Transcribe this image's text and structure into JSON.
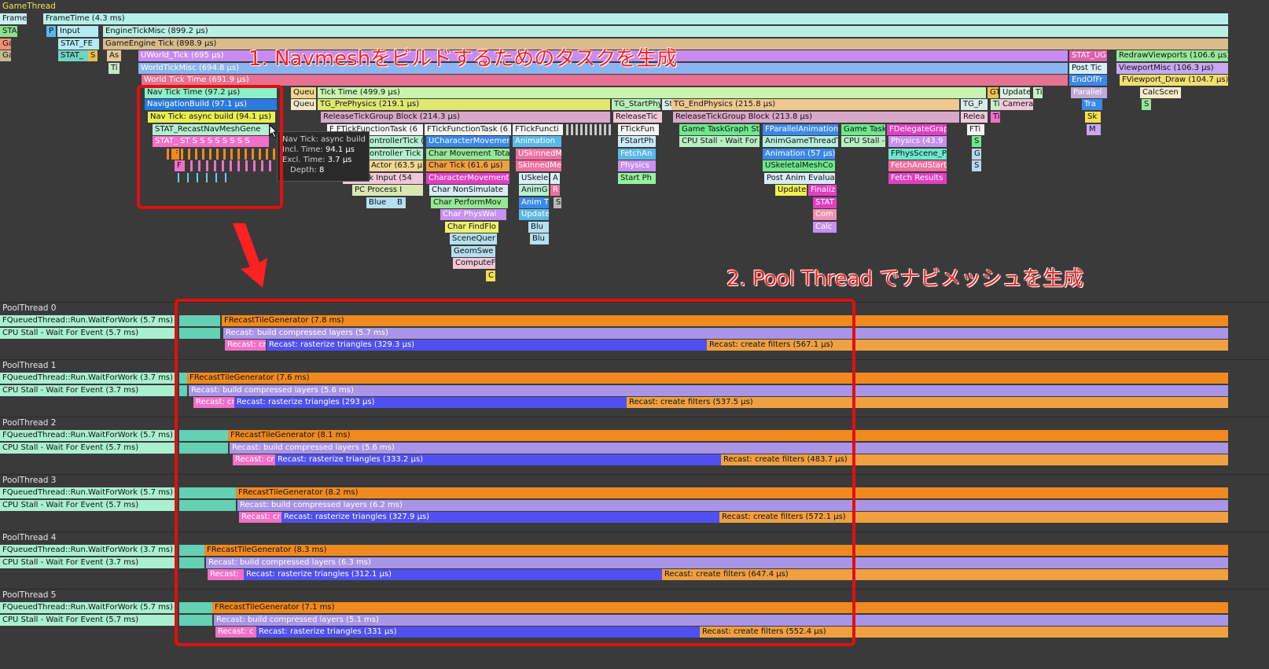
{
  "track_headers": {
    "game_thread": "GameThread",
    "pool_threads": [
      "PoolThread 0",
      "PoolThread 1",
      "PoolThread 2",
      "PoolThread 3",
      "PoolThread 4",
      "PoolThread 5"
    ]
  },
  "colors": {
    "background": "#3a3a3a",
    "annotation_red": "#e01010",
    "tooltip_bg": "#2a2a2a",
    "orange": "#f08a1e",
    "lavender": "#a994e6",
    "blue_purple": "#5050f0",
    "pink": "#f070c8",
    "light_orange": "#f0a040",
    "mint": "#a8f0d0",
    "teal": "#64d0b4"
  },
  "icons": {
    "cursor": "mouse-pointer-icon",
    "arrow": "down-arrow-icon"
  },
  "game_thread": {
    "row0": {
      "frame": "Frame",
      "frame_time": "FrameTime (4.3 ms)"
    },
    "row1": {
      "sta": "STA",
      "p": "P",
      "input": "Input",
      "engine_tick_misc": "EngineTickMisc (899.2 µs)"
    },
    "row2": {
      "ga": "Ga",
      "stat_fe": "STAT_FE",
      "game_engine_tick": "GameEngine Tick (898.9 µs)"
    },
    "row3": {
      "ga": "Ga",
      "stat": "STAT_",
      "s": "S",
      "as": "As",
      "uworld_tick": "UWorld_Tick (695 µs)",
      "stat_ug": "STAT_UG",
      "redraw": "RedrawViewports (106.6 µs)"
    },
    "row4": {
      "ti": "Ti",
      "world_tick_misc": "WorldTickMisc (694.8 µs)",
      "post_tic": "Post Tic",
      "viewport_misc": "ViewportMisc (106.3 µs)"
    },
    "row5": {
      "world_tick_time": "World Tick Time (691.9 µs)",
      "end_of_fr": "EndOfFr",
      "fviewport_draw": "FViewport_Draw (104.7 µs)"
    },
    "row6": {
      "nav_tick_time": "Nav Tick Time (97.2 µs)",
      "queu": "Queu",
      "tick_time": "Tick Time (499.9 µs)",
      "gt": "GT",
      "update": "Update",
      "ti": "Ti",
      "parallel": "Parallel",
      "calc_scen": "CalcScen"
    },
    "row7": {
      "navigation_build": "NavigationBuild (97.1 µs)",
      "queu": "Queu",
      "tg_prephysics": "TG_PrePhysics (219.1 µs)",
      "tg_startphy": "TG_StartPhy",
      "st": "St",
      "tg_endphysics": "TG_EndPhysics (215.8 µs)",
      "tg_p": "TG_P",
      "ti": "Ti",
      "camera": "Camera",
      "tra": "Tra",
      "s": "S"
    },
    "row8": {
      "nav_tick_async": "Nav Tick: async build (94.1 µs)",
      "release_tick_group_1": "ReleaseTickGroup Block (214.3 µs)",
      "release_tic": "ReleaseTic",
      "release_tick_group_2": "ReleaseTickGroup Block (213.8 µs)",
      "relea": "Relea",
      "ti": "Ti",
      "sk": "Sk"
    },
    "row9": {
      "stat_recast": "STAT_RecastNavMeshGene",
      "ftick_task_1": "F FTickFunctionTask (6",
      "ftick_task_2": "FTickFunctionTask (6",
      "ftick_functi": "FTickFuncti",
      "ftick_fun": "FTickFun",
      "game_task_graph": "Game TaskGraph St",
      "fparallel_animation": "FParallelAnimation",
      "game_task": "Game Task",
      "fdelegate_grap": "FDelegateGrap",
      "fti": "FTi",
      "m": "M"
    },
    "row10": {
      "stat_sts": "STAT_ ST S  S  S  S  S  S  S  S",
      "controller_tick_1": "ControllerTick (",
      "ucharacter_movement": "UCharacterMovemen",
      "animation": "Animation",
      "fstartph": "FStartPh",
      "cpu_stall": "CPU Stall - Wait For",
      "anim_game_thread": "AnimGameThreadT",
      "cpu_stall_2": "CPU Stall -",
      "physics": "Physics (43.9",
      "s": "S"
    },
    "row11": {
      "f": "F",
      "controller_tick_2": "Controller Tick",
      "char_movement_tota": "Char Movement Tota",
      "uskinned_m": "USkinnedM",
      "fetch_an": "FetchAn",
      "animation_57": "Animation (57 µs)",
      "fphysscene": "FPhysScene_P",
      "g": "G"
    },
    "row12": {
      "f": "F",
      "k_actor": "k Actor (63.5 µ",
      "char_tick": "Char Tick (61.6 µs)",
      "skinned_me": "SkinnedMe",
      "physics": "Physics",
      "uskeletal_mesh": "USkeletalMeshCo",
      "fetch_and_start": "FetchAndStart",
      "s": "S"
    },
    "row13": {
      "pc_tick_input": "PC Tick Input (54",
      "character_movement": "CharacterMovement",
      "uskele": "USkele",
      "a": "A",
      "start_ph": "Start Ph",
      "post_anim": "Post Anim Evaluat",
      "fetch_results": "Fetch Results"
    },
    "row14": {
      "pc_process": "PC Process I",
      "char_non_simulate": "Char NonSimulate",
      "anim_g": "AnimG",
      "r": "R",
      "update": "Update",
      "finaliz": "Finaliz"
    },
    "row15": {
      "blue": "Blue",
      "b": "B",
      "char_perform_mov": "Char PerformMov",
      "anim_t": "Anim T",
      "s": "S",
      "stat": "STAT"
    },
    "row16": {
      "char_phys_wal": "Char PhysWal",
      "update": "Update",
      "com": "Com"
    },
    "row17": {
      "char_find_flo": "Char FindFlo",
      "blu": "Blu",
      "calc": "Calc"
    },
    "row18": {
      "scene_quer": "SceneQuer",
      "blu": "Blu"
    },
    "row19": {
      "geom_swe": "GeomSwe"
    },
    "row20": {
      "compute_f": "ComputeF"
    },
    "row21": {
      "c": "C"
    }
  },
  "tooltip": {
    "title": "Nav Tick: async build",
    "incl_label": "Incl. Time:",
    "incl_value": "94.1 µs",
    "excl_label": "Excl. Time:",
    "excl_value": "3.7 µs",
    "depth_label": "Depth:",
    "depth_value": "8"
  },
  "pool_threads": [
    {
      "wait": "FQueuedThread::Run.WaitForWork (5.7 ms)",
      "stall": "CPU Stall - Wait For Event (5.7 ms)",
      "generator": "FRecastTileGenerator (7.8 ms)",
      "build": "Recast: build compressed layers (5.7 ms)",
      "cr": "Recast: cr",
      "rasterize": "Recast: rasterize triangles (329.3 µs)",
      "filters": "Recast: create filters (567.1 µs)"
    },
    {
      "wait": "FQueuedThread::Run.WaitForWork (3.7 ms)",
      "stall": "CPU Stall - Wait For Event (3.7 ms)",
      "generator": "FRecastTileGenerator (7.6 ms)",
      "build": "Recast: build compressed layers (5.6 ms)",
      "cr": "Recast: cr",
      "rasterize": "Recast: rasterize triangles (293 µs)",
      "filters": "Recast: create filters (537.5 µs)"
    },
    {
      "wait": "FQueuedThread::Run.WaitForWork (5.7 ms)",
      "stall": "CPU Stall - Wait For Event (5.7 ms)",
      "generator": "FRecastTileGenerator (8.1 ms)",
      "build": "Recast: build compressed layers (5.6 ms)",
      "cr": "Recast: cr",
      "rasterize": "Recast: rasterize triangles (333.2 µs)",
      "filters": "Recast: create filters (483.7 µs)"
    },
    {
      "wait": "FQueuedThread::Run.WaitForWork (5.7 ms)",
      "stall": "CPU Stall - Wait For Event (5.7 ms)",
      "generator": "FRecastTileGenerator (8.2 ms)",
      "build": "Recast: build compressed layers (6.2 ms)",
      "cr": "Recast: cr",
      "rasterize": "Recast: rasterize triangles (327.9 µs)",
      "filters": "Recast: create filters (572.1 µs)"
    },
    {
      "wait": "FQueuedThread::Run.WaitForWork (3.7 ms)",
      "stall": "CPU Stall - Wait For Event (3.7 ms)",
      "generator": "FRecastTileGenerator (8.3 ms)",
      "build": "Recast: build compressed layers (6.3 ms)",
      "cr": "Recast:",
      "rasterize": "Recast: rasterize triangles (312.1 µs)",
      "filters": "Recast: create filters (647.4 µs)"
    },
    {
      "wait": "FQueuedThread::Run.WaitForWork (5.7 ms)",
      "stall": "CPU Stall - Wait For Event (5.7 ms)",
      "generator": "FRecastTileGenerator (7.1 ms)",
      "build": "Recast: build compressed layers (5.1 ms)",
      "cr": "Recast: c",
      "rasterize": "Recast: rasterize triangles (331 µs)",
      "filters": "Recast: create filters (552.4 µs)"
    }
  ],
  "annotations": {
    "step1": "1. Navmeshをビルドするためのタスクを生成",
    "step2": "2. Pool Thread でナビメッシュを生成"
  }
}
